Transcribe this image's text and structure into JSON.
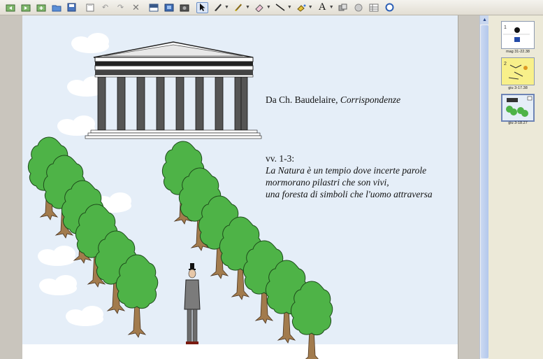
{
  "toolbar": {
    "icons": [
      "previous-page-icon",
      "next-page-icon",
      "add-page-icon",
      "undo-icon",
      "redo-icon",
      "save-icon",
      "delete-icon",
      "screen-shade-icon",
      "capture-icon",
      "select-icon",
      "pen-icon",
      "highlighter-icon",
      "eraser-icon",
      "line-icon",
      "fill-icon",
      "text-icon",
      "shapes-icon",
      "table-icon",
      "properties-icon"
    ],
    "text_tool_glyph": "A"
  },
  "slide": {
    "citation_prefix": "Da Ch. Baudelaire, ",
    "citation_title": "Corrispondenze",
    "verse_ref": "vv. 1-3:",
    "verse_1": "La Natura è un tempio dove incerte parole",
    "verse_2": "mormorano pilastri che son vivi,",
    "verse_3": "una foresta di simboli che l'uomo attraversa"
  },
  "thumbnails": [
    {
      "label": "mag 31-22.38"
    },
    {
      "label": "giu 3-17.38"
    },
    {
      "label": "giu 3-18.27"
    }
  ]
}
